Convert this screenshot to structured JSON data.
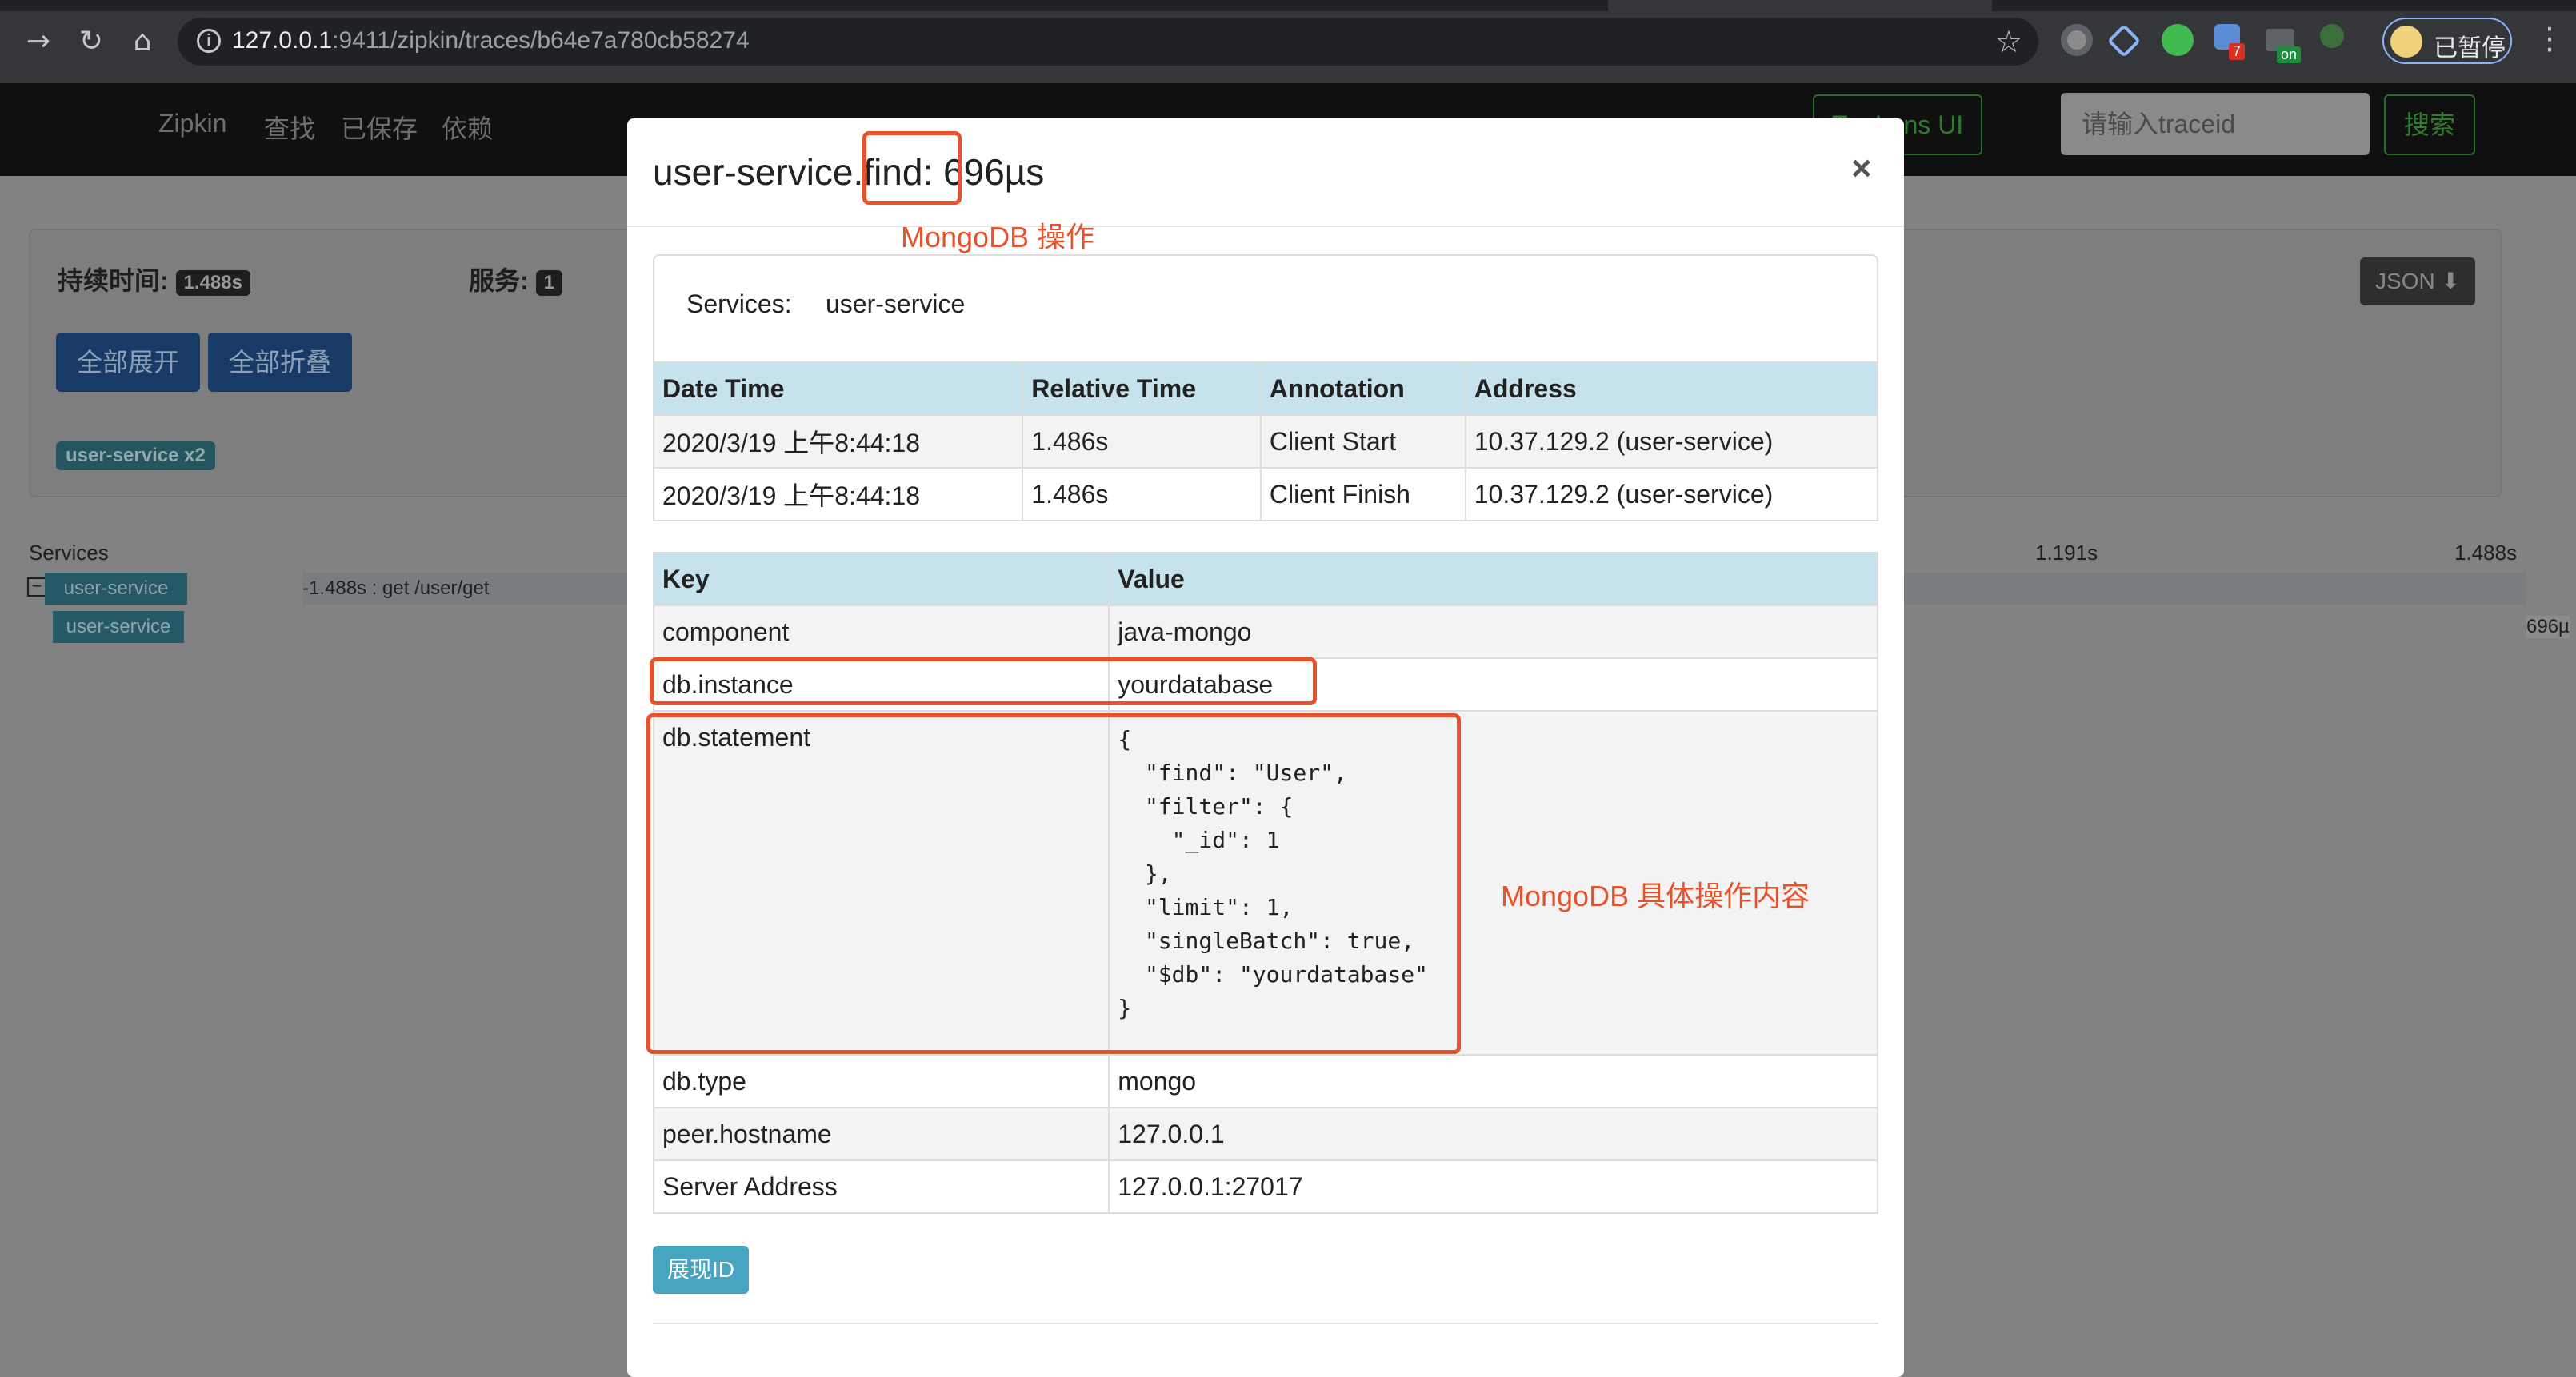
{
  "browser": {
    "url_host": "127.0.0.1",
    "url_rest": ":9411/zipkin/traces/b64e7a780cb58274",
    "profile_label": "已暂停",
    "ext_badge_7": "7",
    "ext_badge_on": "on"
  },
  "navbar": {
    "brand": "Zipkin",
    "links": [
      "查找",
      "已保存",
      "依赖"
    ],
    "lens_button": "Try Lens UI",
    "trace_placeholder": "请输入traceid",
    "search_button": "搜索"
  },
  "summary": {
    "duration_label": "持续时间:",
    "duration_value": "1.488s",
    "services_label": "服务:",
    "services_value": "1",
    "expand_all": "全部展开",
    "collapse_all": "全部折叠",
    "service_filter": "user-service x2",
    "json_button": "JSON"
  },
  "timeline": {
    "services_header": "Services",
    "tick_mid": "1.191s",
    "tick_end": "1.488s",
    "rows": [
      {
        "service": "user-service",
        "label": "-1.488s : get /user/get"
      },
      {
        "service": "user-service",
        "label": "",
        "duration": "696µ"
      }
    ]
  },
  "modal": {
    "title_service": "user-service",
    "title_op": ".find:",
    "title_duration": " 696µs",
    "close": "×",
    "services_label": "Services:",
    "services_value": "user-service",
    "annotations_headers": [
      "Date Time",
      "Relative Time",
      "Annotation",
      "Address"
    ],
    "annotations": [
      {
        "date": "2020/3/19 上午8:44:18",
        "relative": "1.486s",
        "annotation": "Client Start",
        "address": "10.37.129.2 (user-service)"
      },
      {
        "date": "2020/3/19 上午8:44:18",
        "relative": "1.486s",
        "annotation": "Client Finish",
        "address": "10.37.129.2 (user-service)"
      }
    ],
    "tags_headers": [
      "Key",
      "Value"
    ],
    "tags": [
      {
        "key": "component",
        "value": "java-mongo"
      },
      {
        "key": "db.instance",
        "value": "yourdatabase"
      },
      {
        "key": "db.statement",
        "value": "{\n  \"find\": \"User\",\n  \"filter\": {\n    \"_id\": 1\n  },\n  \"limit\": 1,\n  \"singleBatch\": true,\n  \"$db\": \"yourdatabase\"\n}"
      },
      {
        "key": "db.type",
        "value": "mongo"
      },
      {
        "key": "peer.hostname",
        "value": "127.0.0.1"
      },
      {
        "key": "Server Address",
        "value": "127.0.0.1:27017"
      }
    ],
    "show_id_button": "展现ID"
  },
  "annotations_overlay": {
    "op_note": "MongoDB 操作",
    "stmt_note": "MongoDB 具体操作内容",
    "color": "#e5532d"
  }
}
